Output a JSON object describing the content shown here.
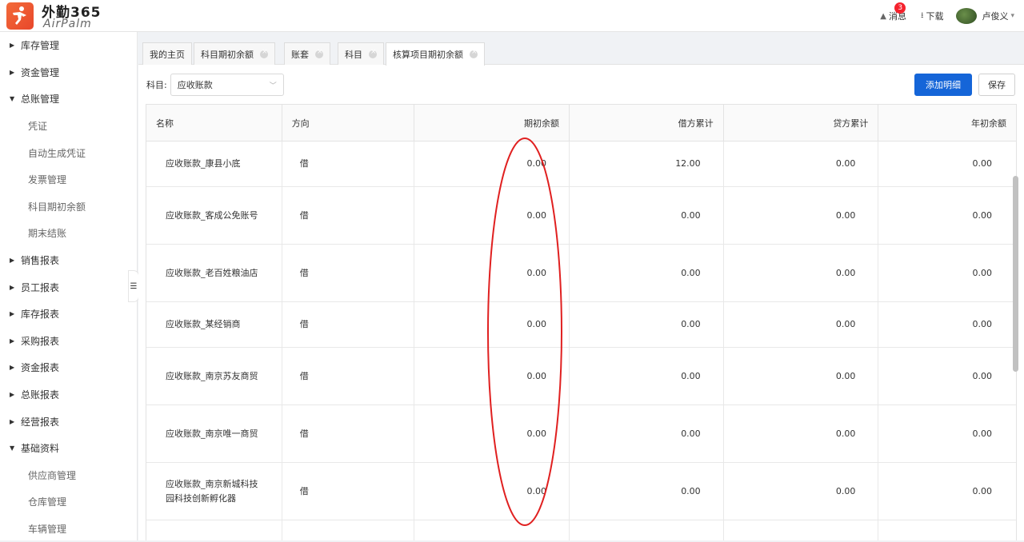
{
  "app": {
    "logo_main": "外勤365",
    "logo_sub": "AirPalm"
  },
  "header": {
    "messages_label": "消息",
    "messages_count": "3",
    "download_label": "下载",
    "user_name": "卢俊义"
  },
  "sidebar": {
    "items": [
      {
        "label": "库存管理",
        "type": "group",
        "expanded": false
      },
      {
        "label": "资金管理",
        "type": "group",
        "expanded": false
      },
      {
        "label": "总账管理",
        "type": "group",
        "expanded": true
      },
      {
        "label": "凭证",
        "type": "sub"
      },
      {
        "label": "自动生成凭证",
        "type": "sub"
      },
      {
        "label": "发票管理",
        "type": "sub"
      },
      {
        "label": "科目期初余额",
        "type": "sub"
      },
      {
        "label": "期末结账",
        "type": "sub"
      },
      {
        "label": "销售报表",
        "type": "group",
        "expanded": false
      },
      {
        "label": "员工报表",
        "type": "group",
        "expanded": false
      },
      {
        "label": "库存报表",
        "type": "group",
        "expanded": false
      },
      {
        "label": "采购报表",
        "type": "group",
        "expanded": false
      },
      {
        "label": "资金报表",
        "type": "group",
        "expanded": false
      },
      {
        "label": "总账报表",
        "type": "group",
        "expanded": false
      },
      {
        "label": "经营报表",
        "type": "group",
        "expanded": false
      },
      {
        "label": "基础资料",
        "type": "group",
        "expanded": true
      },
      {
        "label": "供应商管理",
        "type": "sub"
      },
      {
        "label": "仓库管理",
        "type": "sub"
      },
      {
        "label": "车辆管理",
        "type": "sub"
      }
    ]
  },
  "tabs": [
    {
      "label": "我的主页",
      "closable": false,
      "active": false
    },
    {
      "label": "科目期初余额",
      "closable": true,
      "active": false
    },
    {
      "label": "账套",
      "closable": true,
      "active": false
    },
    {
      "label": "科目",
      "closable": true,
      "active": false
    },
    {
      "label": "核算项目期初余额",
      "closable": true,
      "active": true
    }
  ],
  "filter": {
    "label": "科目:",
    "value": "应收账款"
  },
  "toolbar": {
    "add_label": "添加明细",
    "save_label": "保存"
  },
  "table": {
    "columns": [
      "名称",
      "方向",
      "期初余额",
      "借方累计",
      "贷方累计",
      "年初余额"
    ],
    "rows": [
      {
        "name": "应收账款_康县小底",
        "direction": "借",
        "opening": "0.00",
        "debit": "12.00",
        "credit": "0.00",
        "year_start": "0.00"
      },
      {
        "name": "应收账款_客成公免账号",
        "direction": "借",
        "opening": "0.00",
        "debit": "0.00",
        "credit": "0.00",
        "year_start": "0.00"
      },
      {
        "name": "应收账款_老百姓粮油店",
        "direction": "借",
        "opening": "0.00",
        "debit": "0.00",
        "credit": "0.00",
        "year_start": "0.00"
      },
      {
        "name": "应收账款_某经销商",
        "direction": "借",
        "opening": "0.00",
        "debit": "0.00",
        "credit": "0.00",
        "year_start": "0.00"
      },
      {
        "name": "应收账款_南京苏友商贸",
        "direction": "借",
        "opening": "0.00",
        "debit": "0.00",
        "credit": "0.00",
        "year_start": "0.00"
      },
      {
        "name": "应收账款_南京唯一商贸",
        "direction": "借",
        "opening": "0.00",
        "debit": "0.00",
        "credit": "0.00",
        "year_start": "0.00"
      },
      {
        "name": "应收账款_南京新城科技园科技创新孵化器",
        "direction": "借",
        "opening": "0.00",
        "debit": "0.00",
        "credit": "0.00",
        "year_start": "0.00"
      },
      {
        "name": "",
        "direction": "",
        "opening": "",
        "debit": "",
        "credit": "",
        "year_start": ""
      }
    ]
  },
  "colors": {
    "primary": "#1565d8",
    "highlight": "#e02020",
    "badge": "#f5222d",
    "logo": "#f36b3a"
  }
}
